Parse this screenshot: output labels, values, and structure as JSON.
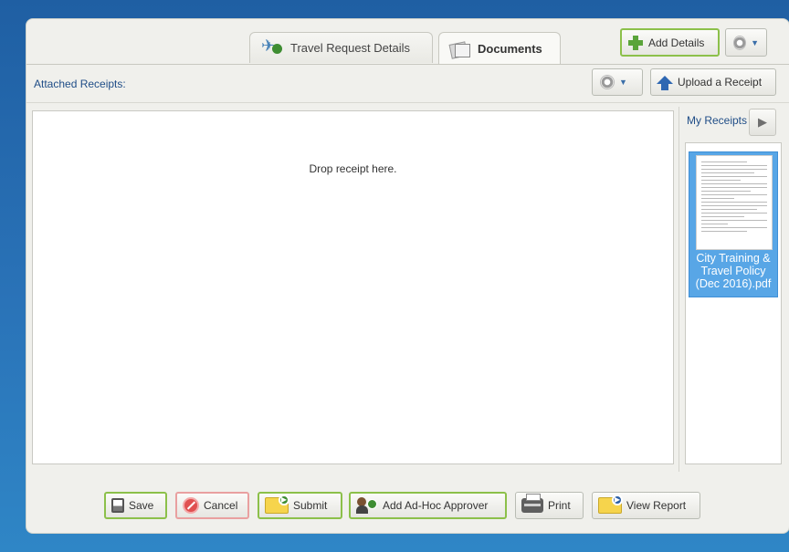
{
  "tabs": [
    {
      "label": "Travel Request Details",
      "icon": "plane-add-icon",
      "active": false
    },
    {
      "label": "Documents",
      "icon": "documents-icon",
      "active": true
    }
  ],
  "header": {
    "add_details_label": "Add Details"
  },
  "receipts_toolbar": {
    "attached_label": "Attached Receipts:",
    "upload_label": "Upload a Receipt"
  },
  "dropzone": {
    "text": "Drop receipt here."
  },
  "my_receipts": {
    "header": "My Receipts",
    "items": [
      {
        "name": "City Training & Travel Policy (Dec 2016).pdf"
      }
    ]
  },
  "footer": {
    "save_label": "Save",
    "cancel_label": "Cancel",
    "submit_label": "Submit",
    "adhoc_label": "Add Ad-Hoc Approver",
    "print_label": "Print",
    "view_report_label": "View Report"
  },
  "colors": {
    "background": "#2a73b8",
    "link_text": "#1f4d87",
    "selected_receipt": "#58a6e6",
    "green_border": "#8cc04a",
    "red_border": "#e9a0a0"
  }
}
